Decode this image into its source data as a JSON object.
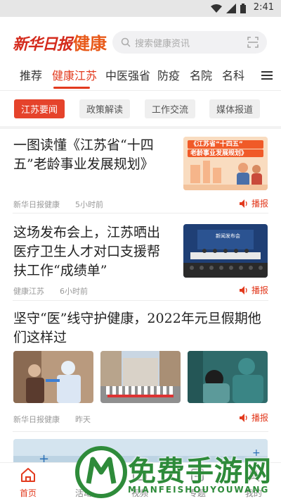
{
  "status_bar": {
    "time": "2:41"
  },
  "header": {
    "logo_brand": "新华日报",
    "logo_sub": "健康",
    "search_placeholder": "搜索健康资讯"
  },
  "tabs": [
    {
      "label": "推荐"
    },
    {
      "label": "健康江苏",
      "active": true
    },
    {
      "label": "中医强省"
    },
    {
      "label": "防疫"
    },
    {
      "label": "名院"
    },
    {
      "label": "名科"
    }
  ],
  "subtabs": [
    {
      "label": "江苏要闻",
      "active": true
    },
    {
      "label": "政策解读"
    },
    {
      "label": "工作交流"
    },
    {
      "label": "媒体报道"
    }
  ],
  "articles": [
    {
      "title": "一图读懂《江苏省“十四五”老龄事业发展规划》",
      "source": "新华日报健康",
      "time": "5小时前",
      "play_label": "播报",
      "thumb_text_1": "《江苏省“十四五”",
      "thumb_text_2": "老龄事业发展规划》"
    },
    {
      "title": "这场发布会上，江苏晒出医疗卫生人才对口支援帮扶工作“成绩单”",
      "source": "健康江苏",
      "time": "6小时前",
      "play_label": "播报",
      "thumb_text_1": "新闻发布会"
    },
    {
      "title": "坚守“医”线守护健康，2022年元旦假期他们这样过",
      "source": "新华日报健康",
      "time": "昨天",
      "play_label": "播报"
    }
  ],
  "bottom_nav": [
    {
      "label": "首页",
      "active": true
    },
    {
      "label": "活动"
    },
    {
      "label": "视频"
    },
    {
      "label": "专题"
    },
    {
      "label": "我的"
    }
  ],
  "watermark": {
    "text": "免费手游网",
    "pinyin": "MIANFEISHOUYOUWANG"
  },
  "colors": {
    "accent": "#e23a1e",
    "chip_active": "#e5432b",
    "logo_red": "#d42a1c",
    "logo_orange": "#e85a1a"
  }
}
